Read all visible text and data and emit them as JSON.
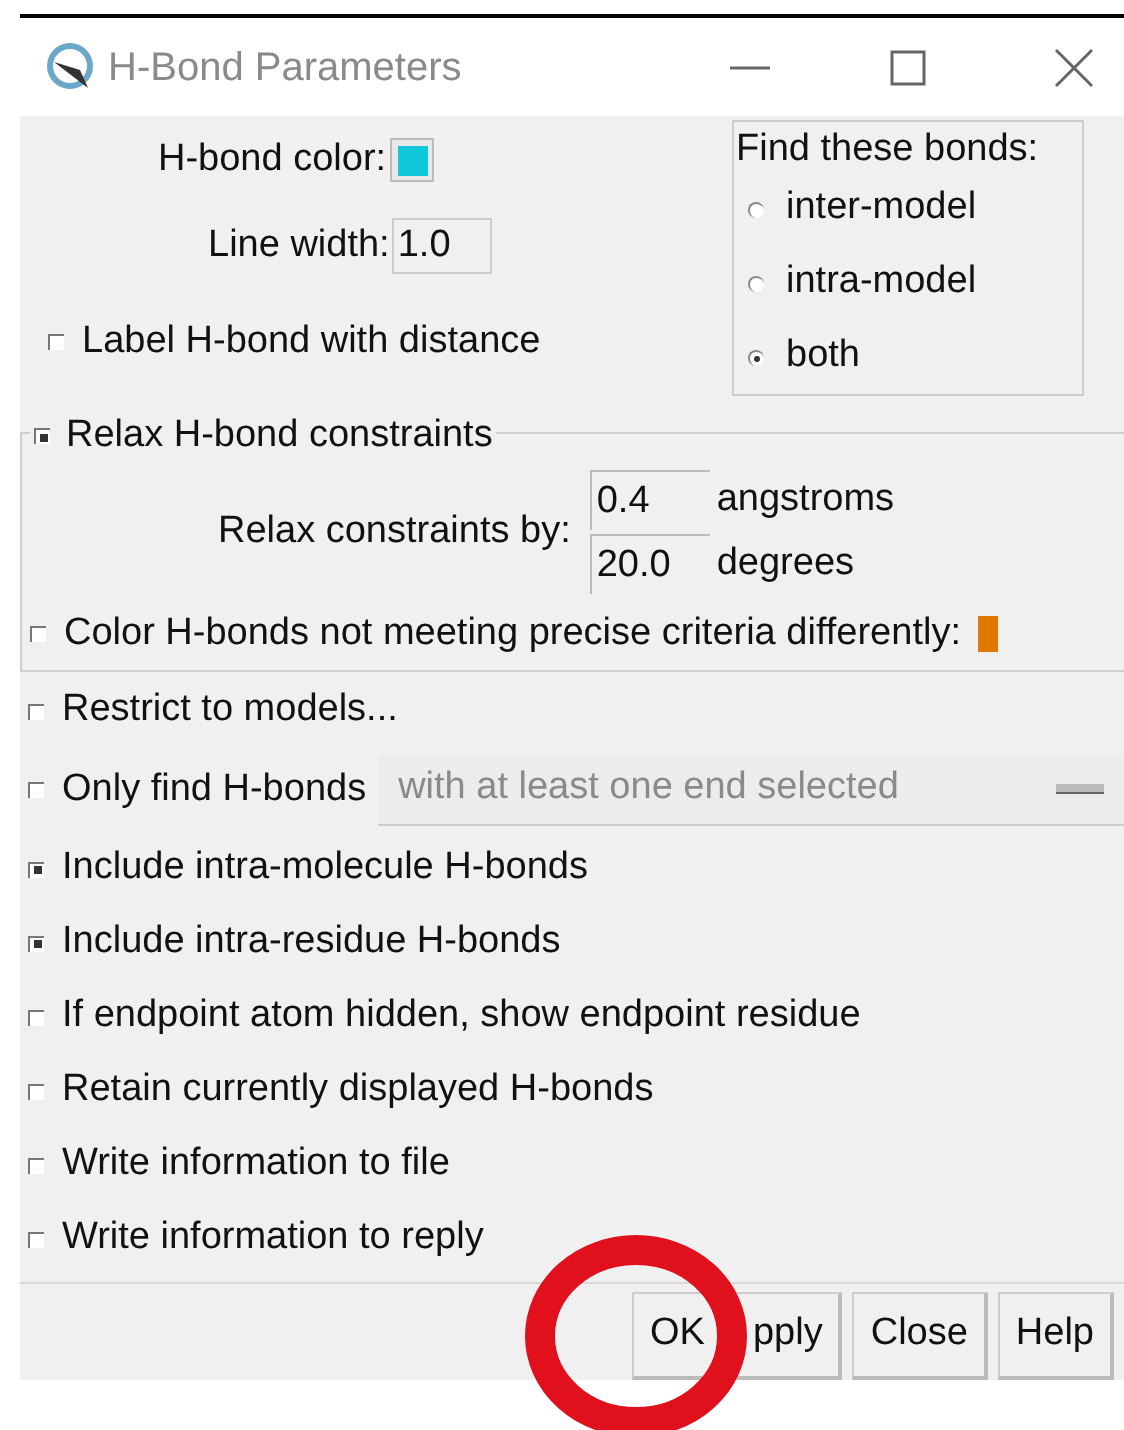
{
  "window": {
    "title": "H-Bond Parameters"
  },
  "color_label": "H-bond color:",
  "hbond_swatch": {
    "color": "#10c8dc"
  },
  "line_width": {
    "label": "Line width:",
    "value": "1.0"
  },
  "label_distance": {
    "label": "Label H-bond with distance",
    "checked": false
  },
  "find_bonds": {
    "title": "Find these bonds:",
    "options": [
      {
        "label": "inter-model",
        "selected": false
      },
      {
        "label": "intra-model",
        "selected": false
      },
      {
        "label": "both",
        "selected": true
      }
    ]
  },
  "relax": {
    "label": "Relax H-bond constraints",
    "checked": true,
    "by_label": "Relax constraints by:",
    "fields": [
      {
        "value": "0.4",
        "unit": "angstroms"
      },
      {
        "value": "20.0",
        "unit": "degrees"
      }
    ],
    "color_diff": {
      "label": "Color H-bonds not meeting precise criteria differently:",
      "checked": false,
      "color": "#e07800"
    }
  },
  "options": [
    {
      "kind": "check",
      "label": "Restrict to models...",
      "checked": false
    },
    {
      "kind": "dropdown",
      "label": "Only find H-bonds",
      "checked": false,
      "value": "with at least one end selected"
    },
    {
      "kind": "check",
      "label": "Include intra-molecule H-bonds",
      "checked": true
    },
    {
      "kind": "check",
      "label": "Include intra-residue H-bonds",
      "checked": true
    },
    {
      "kind": "check",
      "label": "If endpoint atom hidden, show endpoint residue",
      "checked": false
    },
    {
      "kind": "check",
      "label": "Retain currently displayed H-bonds",
      "checked": false
    },
    {
      "kind": "check",
      "label": "Write information to file",
      "checked": false
    },
    {
      "kind": "check",
      "label": "Write information to reply",
      "checked": false
    }
  ],
  "buttons": [
    "OK",
    "pply",
    "Close",
    "Help"
  ]
}
